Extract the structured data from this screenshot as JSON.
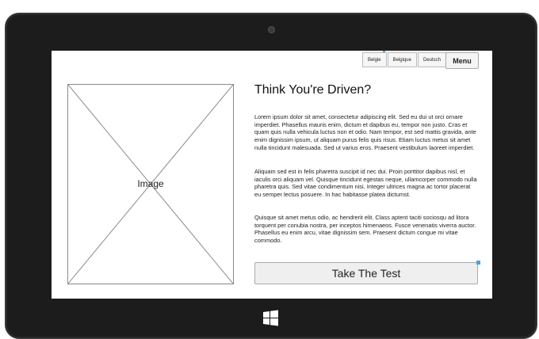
{
  "header": {
    "languages": [
      "Belgie",
      "Belgique",
      "Deutsch"
    ],
    "menu_label": "Menu"
  },
  "image_placeholder": {
    "label": "Image"
  },
  "content": {
    "title": "Think You're Driven?",
    "paragraphs": [
      "Lorem ipsum dolor sit amet, consectetur adipiscing elit. Sed eu dui ut orci ornare imperdiet. Phasellus mauris enim, dictum et dapibus eu, tempor non justo. Cras et quam quis nulla vehicula luctus non et odio. Nam tempor, est sed mattis gravida, ante enim dignissim ipsum, ut aliquam purus felis quis risus. Etiam luctus metus sit amet nulla tincidunt malesuada. Sed ut varius eros. Praesent vestibulum laoreet imperdiet.",
      "Aliquam sed est in felis pharetra suscipit id nec dui. Proin porttitor dapibus nisl, et iaculis orci aliquam vel. Quisque tincidunt egestas neque, ullamcorper commodo nulla pharetra quis. Sed vitae condimentum nisi. Integer ultrices magna ac tortor placerat eu semper lectus posuere. In hac habitasse platea dictumst.",
      "Quisque sit amet metus odio, ac hendrerit elit. Class aptent taciti sociosqu ad litora torquent per conubia nostra, per inceptos himenaeos. Fusce venenatis viverra auctor. Phasellus eu enim arcu, vitae dignissim sem. Praesent dictum congue mi vitae commodo."
    ],
    "cta_label": "Take The Test"
  },
  "device": {
    "home_button_icon": "windows-logo-icon",
    "accent_color": "#4aa3df"
  }
}
